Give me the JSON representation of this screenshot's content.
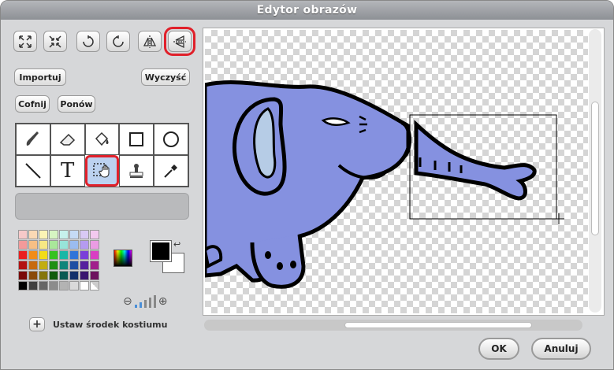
{
  "window": {
    "title": "Edytor obrazów"
  },
  "toolbar": {
    "icons": [
      "expand-icon",
      "shrink-icon",
      "rotate-left-icon",
      "rotate-right-icon",
      "flip-horizontal-icon",
      "flip-vertical-icon"
    ]
  },
  "buttons": {
    "import": "Importuj",
    "clear": "Wyczyść",
    "undo": "Cofnij",
    "redo": "Ponów"
  },
  "tools": [
    "paintbrush",
    "eraser",
    "fill",
    "rectangle",
    "ellipse",
    "line",
    "text",
    "select",
    "stamp",
    "eyedropper"
  ],
  "tools_text_glyph": "T",
  "selected_tool": "select",
  "palette": [
    "#f7c9c9",
    "#fbd9b5",
    "#fbf3b5",
    "#d6f5c2",
    "#c6f1ec",
    "#c5dbf5",
    "#d9c9f5",
    "#f3c9ef",
    "#f29a9a",
    "#f7bf85",
    "#f7e884",
    "#a9e79a",
    "#97e4d9",
    "#9bbcf0",
    "#b59bf0",
    "#eb9ce3",
    "#ea1f1f",
    "#f28c18",
    "#f2dc18",
    "#35c21f",
    "#19b7a6",
    "#2f74d9",
    "#7a3ed9",
    "#d93ec3",
    "#b31212",
    "#c76a0f",
    "#c2ad0f",
    "#1f8f14",
    "#0f857a",
    "#1e4ea3",
    "#55209e",
    "#a11f8c",
    "#7a0909",
    "#8a490a",
    "#857509",
    "#125c0b",
    "#0a5a52",
    "#13306b",
    "#3a1670",
    "#6e115e",
    "#000000",
    "#404040",
    "#666666",
    "#8c8c8c",
    "#b3b3b3",
    "#d9d9d9",
    "#ffffff",
    "#transparent"
  ],
  "colors": {
    "foreground": "#000000",
    "background": "#ffffff",
    "accent_highlight": "#e0202a"
  },
  "set_center_label": "Ustaw środek kostiumu",
  "dialog": {
    "ok": "OK",
    "cancel": "Anuluj"
  },
  "zoom": {
    "out_icon": "zoom-out-icon",
    "in_icon": "zoom-in-icon",
    "level_bars_total": 5,
    "level_bars_active": 2
  }
}
